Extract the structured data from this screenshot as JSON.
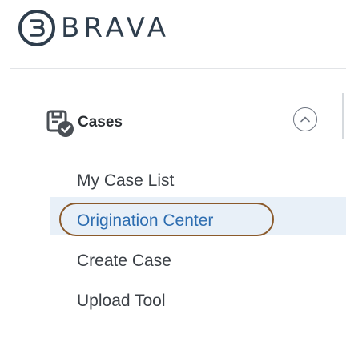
{
  "brand": {
    "name": "BRAVA",
    "color": "#2f3e4d"
  },
  "nav": {
    "section": {
      "label": "Cases",
      "icon": "cases-check-icon",
      "toggle_icon": "chevron-up-icon",
      "expanded": true
    },
    "items": [
      {
        "label": "My Case List",
        "active": false
      },
      {
        "label": "Origination Center",
        "active": true
      },
      {
        "label": "Create Case",
        "active": false
      },
      {
        "label": "Upload Tool",
        "active": false
      }
    ]
  },
  "colors": {
    "active_background": "#e8f0f8",
    "active_text": "#2d6db0",
    "highlight_ring": "#8b5a2b"
  }
}
